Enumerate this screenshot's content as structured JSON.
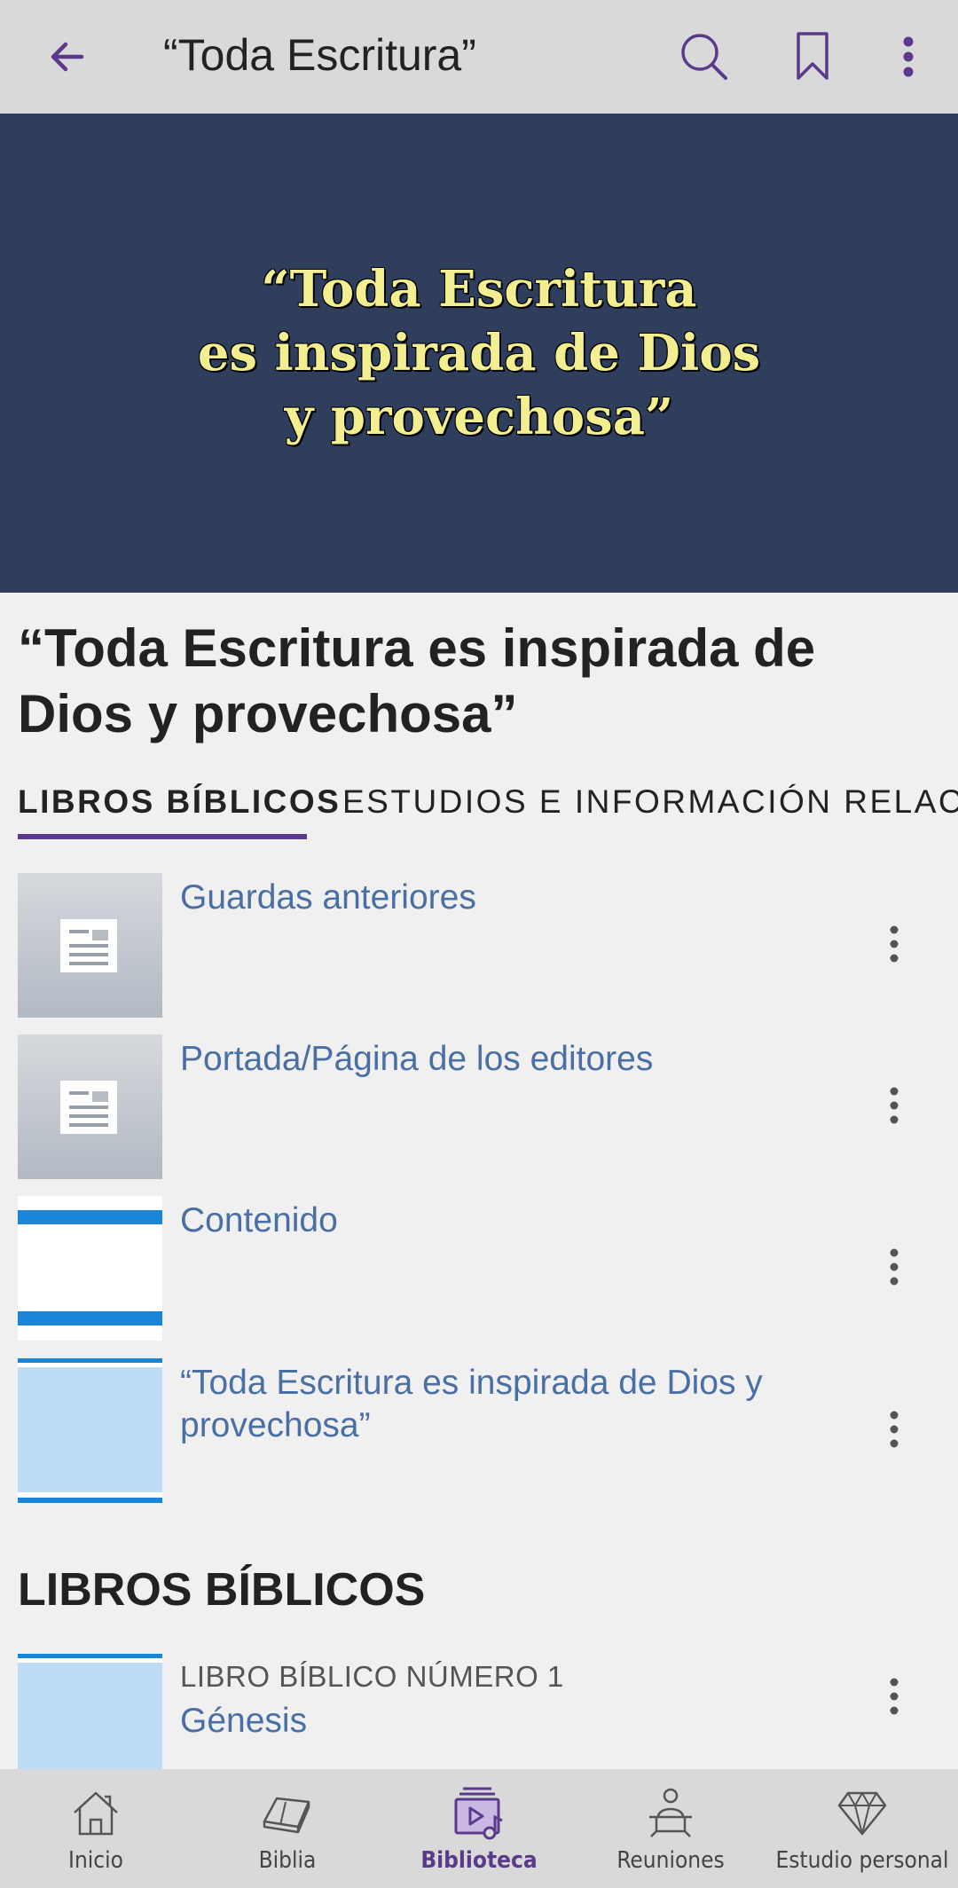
{
  "appbar": {
    "title": "“Toda Escritura”",
    "back_icon": "arrow-left-icon",
    "search_icon": "search-icon",
    "bookmark_icon": "bookmark-icon",
    "more_icon": "more-vertical-icon"
  },
  "banner": {
    "text": "“Toda Escritura\nes inspirada de Dios\ny provechosa”",
    "background": "#2e3e5c",
    "text_color": "#f3ee8f"
  },
  "heading": "“Toda Escritura es inspirada de Dios y provechosa”",
  "tabs": [
    {
      "label": "LIBROS BÍBLICOS",
      "active": true
    },
    {
      "label": "ESTUDIOS E INFORMACIÓN RELACIONADA",
      "active": false
    }
  ],
  "items": [
    {
      "title": "Guardas anteriores",
      "thumb": "document-icon"
    },
    {
      "title": "Portada/Página de los editores",
      "thumb": "document-icon"
    },
    {
      "title": "Contenido",
      "thumb": "contents-thumbnail"
    },
    {
      "title": "“Toda Escritura es inspirada de Dios y provechosa”",
      "thumb": "publication-thumbnail"
    }
  ],
  "section": {
    "title": "LIBROS BÍBLICOS",
    "books": [
      {
        "label": "LIBRO BÍBLICO NÚMERO 1",
        "name": "Génesis"
      }
    ]
  },
  "bottom_nav": [
    {
      "label": "Inicio",
      "icon": "home-icon",
      "active": false
    },
    {
      "label": "Biblia",
      "icon": "bible-icon",
      "active": false
    },
    {
      "label": "Biblioteca",
      "icon": "library-icon",
      "active": true
    },
    {
      "label": "Reuniones",
      "icon": "meetings-icon",
      "active": false
    },
    {
      "label": "Estudio personal",
      "icon": "diamond-icon",
      "active": false
    }
  ],
  "colors": {
    "accent": "#5b3a8c",
    "link": "#4a6fa5",
    "bar": "#d9d9d9",
    "thumb_blue": "#1a85d6"
  }
}
